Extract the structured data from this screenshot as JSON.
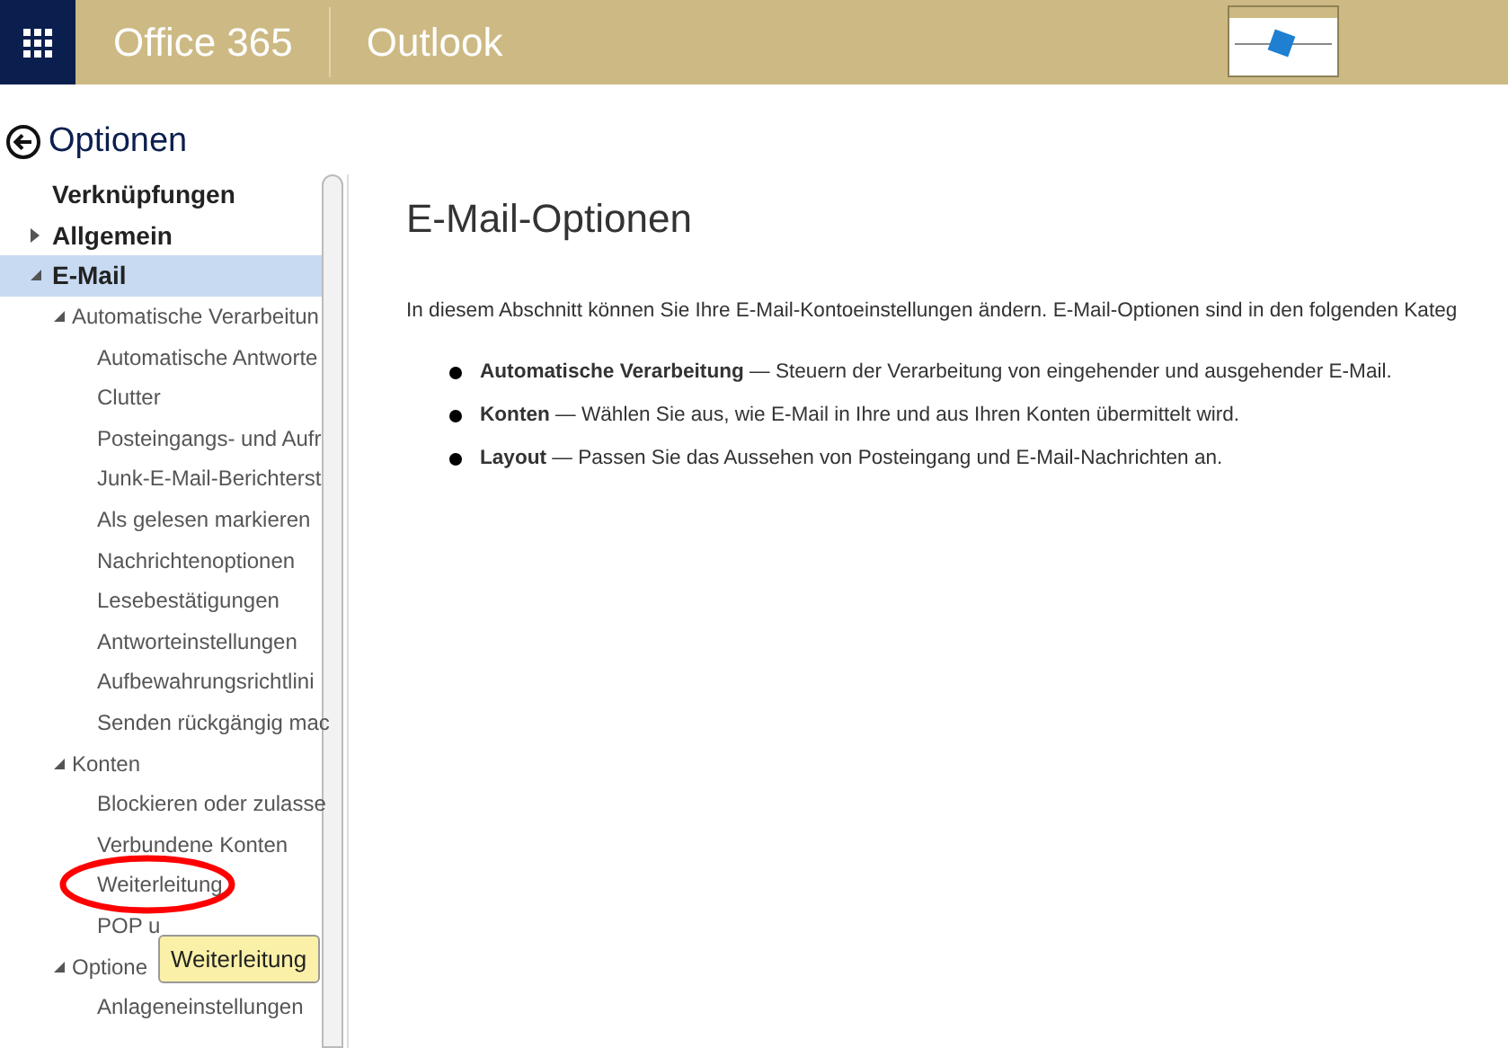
{
  "header": {
    "suite": "Office 365",
    "app": "Outlook"
  },
  "page_title": "Optionen",
  "nav": [
    {
      "label": "Verknüpfungen",
      "selected": false
    },
    {
      "label": "Allgemein",
      "selected": false,
      "expanded": false
    },
    {
      "label": "E-Mail",
      "selected": true,
      "expanded": true,
      "children": [
        {
          "label": "Automatische Verarbeitun",
          "selected": false,
          "expanded": true,
          "children": [
            {
              "label": "Automatische Antworte",
              "selected": false
            },
            {
              "label": "Clutter",
              "selected": false
            },
            {
              "label": "Posteingangs- und Aufr",
              "selected": false
            },
            {
              "label": "Junk-E-Mail-Berichterst",
              "selected": false
            },
            {
              "label": "Als gelesen markieren",
              "selected": false
            },
            {
              "label": "Nachrichtenoptionen",
              "selected": false
            },
            {
              "label": "Lesebestätigungen",
              "selected": false
            },
            {
              "label": "Antworteinstellungen",
              "selected": false
            },
            {
              "label": "Aufbewahrungsrichtlini",
              "selected": false
            },
            {
              "label": "Senden rückgängig mac",
              "selected": false
            }
          ]
        },
        {
          "label": "Konten",
          "selected": false,
          "expanded": true,
          "children": [
            {
              "label": "Blockieren oder zulasse",
              "selected": false
            },
            {
              "label": "Verbundene Konten",
              "selected": false
            },
            {
              "label": "Weiterleitung",
              "selected": false
            },
            {
              "label": "POP u",
              "selected": false
            }
          ]
        },
        {
          "label": "Optione",
          "selected": false,
          "expanded": true,
          "children": [
            {
              "label": "Anlageneinstellungen",
              "selected": false
            }
          ]
        }
      ]
    }
  ],
  "tooltip": {
    "text": "Weiterleitung"
  },
  "content": {
    "title": "E-Mail-Optionen",
    "intro": "In diesem Abschnitt können Sie Ihre E-Mail-Kontoeinstellungen ändern. E-Mail-Optionen sind in den folgenden Kateg",
    "bullets": [
      {
        "term": "Automatische Verarbeitung",
        "text": "— Steuern der Verarbeitung von eingehender und ausgehender E-Mail."
      },
      {
        "term": "Konten",
        "text": "— Wählen Sie aus, wie E-Mail in Ihre und aus Ihren Konten übermittelt wird."
      },
      {
        "term": "Layout",
        "text": "— Passen Sie das Aussehen von Posteingang und E-Mail-Nachrichten an."
      }
    ]
  }
}
